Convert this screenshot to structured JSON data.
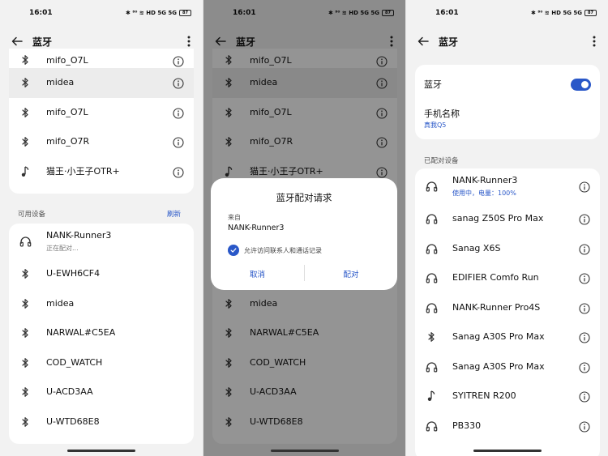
{
  "status": {
    "time": "16:01",
    "icons_text": "✱ ⁸⁰ ≋ HD 5G 5G",
    "battery": "87"
  },
  "appbar": {
    "title": "蓝牙"
  },
  "screen1": {
    "top_list": [
      {
        "name": "mifo_O7L",
        "icon": "bluetooth-icon",
        "partial": true
      },
      {
        "name": "midea",
        "icon": "bluetooth-icon"
      },
      {
        "name": "mifo_O7L",
        "icon": "bluetooth-icon"
      },
      {
        "name": "mifo_O7R",
        "icon": "bluetooth-icon"
      },
      {
        "name": "猫王·小王子OTR+",
        "icon": "music-note-icon"
      }
    ],
    "available_label": "可用设备",
    "refresh": "刷新",
    "available": [
      {
        "name": "NANK-Runner3",
        "sub": "正在配对...",
        "icon": "headphones-icon"
      },
      {
        "name": "U-EWH6CF4",
        "icon": "bluetooth-icon"
      },
      {
        "name": "midea",
        "icon": "bluetooth-icon"
      },
      {
        "name": "NARWAL#C5EA",
        "icon": "bluetooth-icon"
      },
      {
        "name": "COD_WATCH",
        "icon": "bluetooth-icon"
      },
      {
        "name": "U-ACD3AA",
        "icon": "bluetooth-icon"
      },
      {
        "name": "U-WTD68E8",
        "icon": "bluetooth-icon"
      }
    ]
  },
  "screen2": {
    "dialog": {
      "title": "蓝牙配对请求",
      "from_label": "来自",
      "device": "NANK-Runner3",
      "allow_label": "允许访问联系人和通话记录",
      "cancel": "取消",
      "pair": "配对"
    }
  },
  "screen3": {
    "bluetooth_label": "蓝牙",
    "phone_name_label": "手机名称",
    "phone_name_value": "真我Q5",
    "paired_label": "已配对设备",
    "paired": [
      {
        "name": "NANK-Runner3",
        "sub": "使用中，电量：100%",
        "icon": "headphones-icon"
      },
      {
        "name": "sanag Z50S Pro Max",
        "icon": "headphones-icon"
      },
      {
        "name": "Sanag X6S",
        "icon": "headphones-icon"
      },
      {
        "name": "EDIFIER Comfo Run",
        "icon": "headphones-icon"
      },
      {
        "name": "NANK-Runner Pro4S",
        "icon": "headphones-icon"
      },
      {
        "name": "Sanag A30S Pro Max",
        "icon": "bluetooth-icon"
      },
      {
        "name": "Sanag A30S Pro Max",
        "icon": "headphones-icon"
      },
      {
        "name": "SYITREN R200",
        "icon": "music-note-icon"
      },
      {
        "name": "PB330",
        "icon": "headphones-icon"
      }
    ]
  },
  "colors": {
    "accent": "#2957c8",
    "background": "#f2f2f2",
    "card": "#ffffff"
  }
}
